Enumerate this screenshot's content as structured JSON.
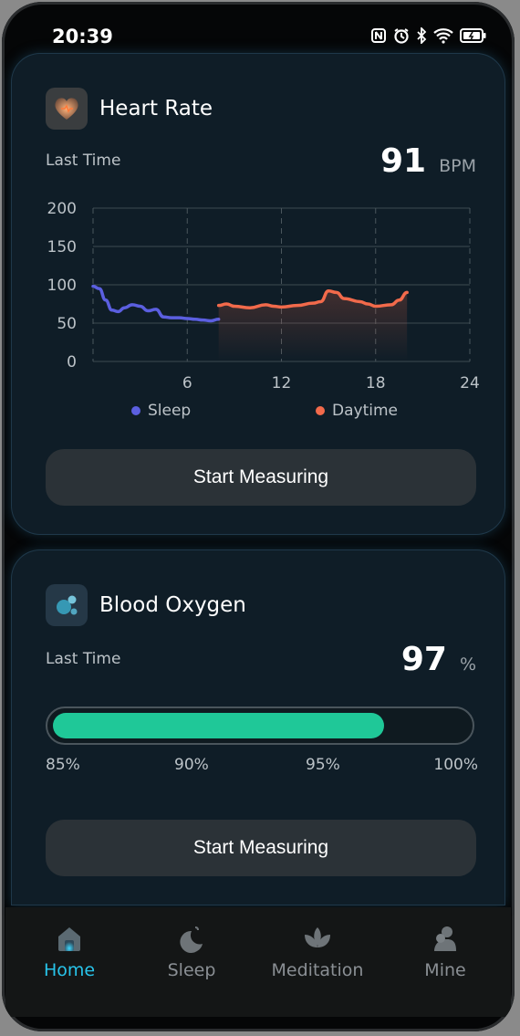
{
  "status": {
    "time": "20:39"
  },
  "heart": {
    "title": "Heart Rate",
    "last_label": "Last Time",
    "value": "91",
    "unit": "BPM",
    "button": "Start Measuring",
    "legend_sleep": "Sleep",
    "legend_day": "Daytime"
  },
  "oxygen": {
    "title": "Blood Oxygen",
    "last_label": "Last Time",
    "value": "97",
    "unit": "%",
    "button": "Start Measuring",
    "progress_fraction": 0.8,
    "ticks": [
      "85%",
      "90%",
      "95%",
      "100%"
    ]
  },
  "nav": {
    "home": "Home",
    "sleep": "Sleep",
    "meditation": "Meditation",
    "mine": "Mine"
  },
  "colors": {
    "sleep": "#5b5fe0",
    "day": "#f26a4b",
    "oxygen": "#1fc898",
    "active": "#28c4ea"
  },
  "chart_data": {
    "type": "line",
    "xlim": [
      0,
      24
    ],
    "ylim": [
      0,
      200
    ],
    "x_ticks": [
      "6",
      "12",
      "18",
      "24"
    ],
    "y_ticks": [
      "200",
      "150",
      "100",
      "50",
      "0"
    ],
    "series": [
      {
        "name": "Sleep",
        "x": [
          0,
          0.4,
          0.8,
          1.2,
          1.6,
          2,
          2.5,
          3,
          3.5,
          4,
          4.5,
          5,
          5.5,
          6,
          6.5,
          7,
          7.5,
          8
        ],
        "y": [
          98,
          95,
          80,
          67,
          65,
          70,
          74,
          72,
          66,
          68,
          58,
          57,
          57,
          56,
          55,
          54,
          53,
          55
        ]
      },
      {
        "name": "Daytime",
        "x": [
          8,
          8.5,
          9,
          10,
          11,
          11.5,
          12,
          13,
          14,
          14.5,
          15,
          15.5,
          16,
          17,
          17.5,
          18,
          19,
          19.5,
          20
        ],
        "y": [
          73,
          75,
          72,
          70,
          74,
          72,
          71,
          73,
          76,
          78,
          92,
          90,
          82,
          78,
          75,
          72,
          74,
          80,
          90
        ]
      }
    ]
  }
}
